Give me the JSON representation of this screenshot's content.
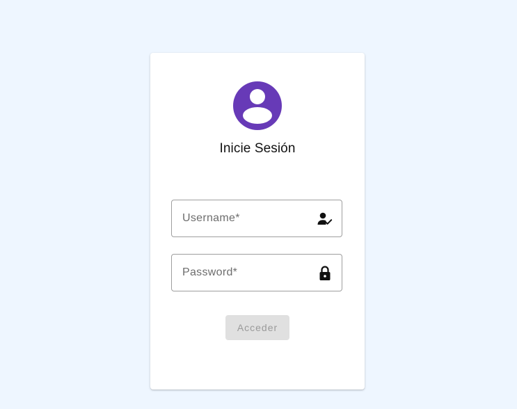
{
  "colors": {
    "page_background": "#eef6ff",
    "avatar_accent": "#673ab7",
    "button_disabled_bg": "#e0e0e0",
    "button_disabled_text": "#9a9a9a"
  },
  "login": {
    "title": "Inicie Sesión",
    "avatar_icon": "account-circle-icon",
    "username": {
      "placeholder": "Username*",
      "value": "",
      "icon": "person-check-icon"
    },
    "password": {
      "placeholder": "Password*",
      "value": "",
      "icon": "lock-icon"
    },
    "submit_label": "Acceder",
    "submit_disabled": true
  }
}
